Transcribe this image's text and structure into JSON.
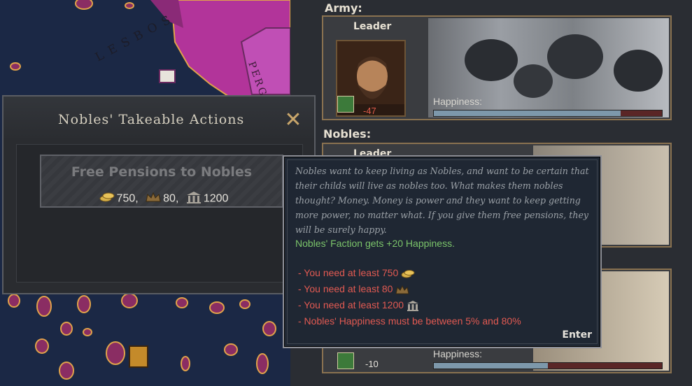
{
  "map": {
    "labels": [
      "LESBOS",
      "PERGAMON"
    ]
  },
  "right_panel": {
    "army": {
      "title": "Army:",
      "leader_label": "Leader",
      "leader_modifier": "-47",
      "happiness_label": "Happiness:",
      "happiness": 0.82
    },
    "nobles": {
      "title": "Nobles:",
      "leader_label": "Leader"
    },
    "third": {
      "leader_modifier": "-10",
      "happiness_label": "Happiness:",
      "happiness": 0.5
    }
  },
  "actions_window": {
    "title": "Nobles' Takeable Actions",
    "close_icon": "close-x",
    "action": {
      "name": "Free Pensions to Nobles",
      "costs": [
        {
          "icon": "coins-icon",
          "value": "750,"
        },
        {
          "icon": "crown-icon",
          "value": "80,"
        },
        {
          "icon": "temple-icon",
          "value": "1200"
        }
      ]
    }
  },
  "tooltip": {
    "description": "Nobles want to keep living as Nobles, and want to be certain that their childs will live as nobles too. What makes them nobles thought? Money. Money is power and they want to keep getting more power, no matter what. If you give them free pensions, they will be surely happy.",
    "effect": "Nobles' Faction gets +20 Happiness.",
    "requirements": [
      {
        "text": "- You need at least 750",
        "icon": "coins-icon"
      },
      {
        "text": "- You need at least 80",
        "icon": "crown-icon"
      },
      {
        "text": "- You need at least 1200",
        "icon": "temple-icon"
      },
      {
        "text": "- Nobles' Happiness must be between 5% and 80%",
        "icon": ""
      }
    ],
    "enter_label": "Enter"
  },
  "colors": {
    "effect_green": "#7bc46a",
    "requirement_red": "#e25a52",
    "frame_gold": "#8a7250"
  }
}
